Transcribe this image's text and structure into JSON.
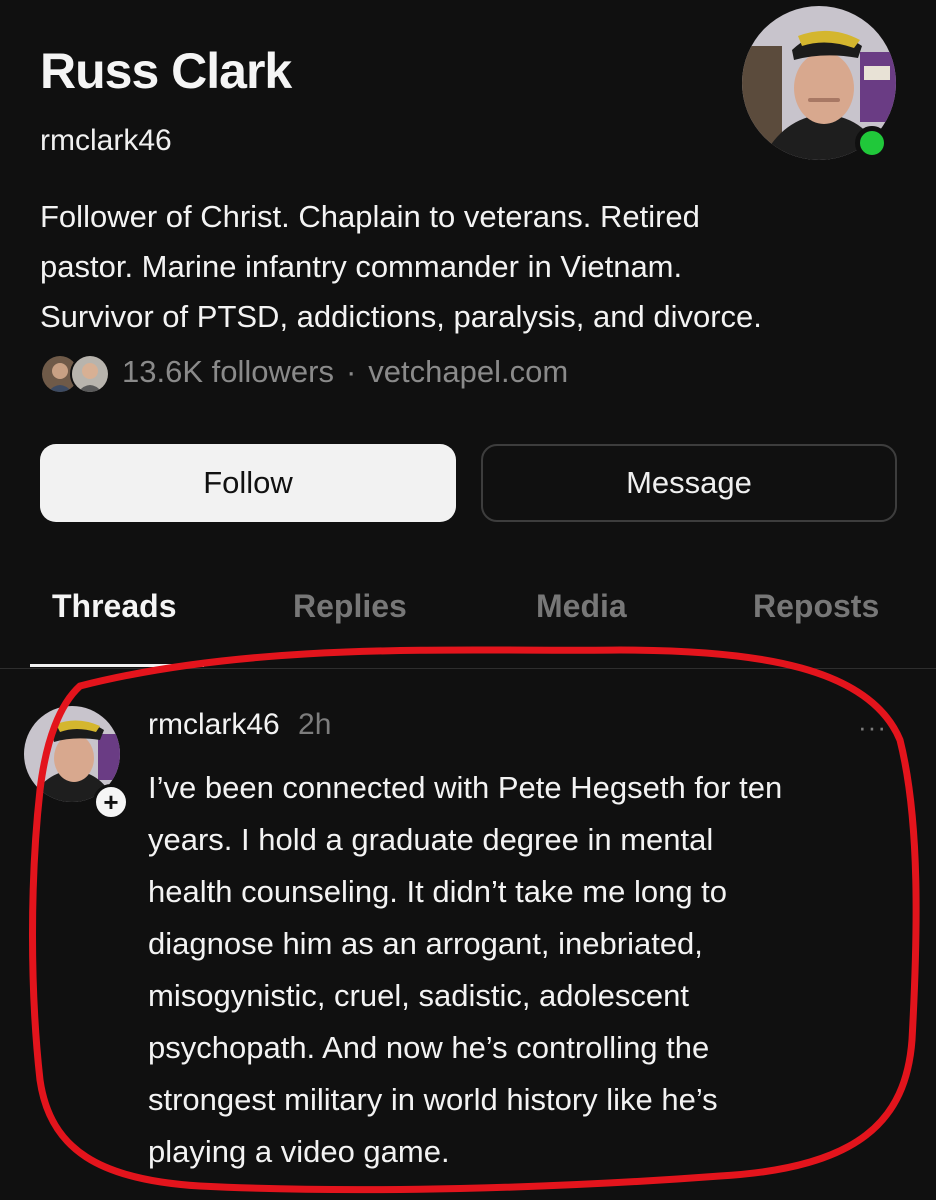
{
  "profile": {
    "display_name": "Russ Clark",
    "username": "rmclark46",
    "bio_lines": [
      "Follower of Christ. Chaplain to veterans. Retired",
      "pastor. Marine infantry commander in Vietnam.",
      "Survivor of PTSD, addictions, paralysis, and divorce."
    ],
    "followers": "13.6K followers",
    "separator": "·",
    "website": "vetchapel.com",
    "online_color": "#20c83a"
  },
  "actions": {
    "follow_label": "Follow",
    "message_label": "Message"
  },
  "tabs": [
    {
      "label": "Threads",
      "active": true
    },
    {
      "label": "Replies",
      "active": false
    },
    {
      "label": "Media",
      "active": false
    },
    {
      "label": "Reposts",
      "active": false
    }
  ],
  "post": {
    "author": "rmclark46",
    "time": "2h",
    "more": "···",
    "follow_plus": "+",
    "lines": [
      "I’ve been connected with Pete Hegseth for ten",
      "years. I hold a graduate degree in mental",
      "health counseling. It didn’t take me long to",
      "diagnose him as an arrogant, inebriated,",
      "misogynistic, cruel, sadistic, adolescent",
      "psychopath. And now he’s controlling the",
      "strongest military in world history like he’s",
      "playing a video game."
    ]
  },
  "annotation": {
    "color": "#e3141c"
  }
}
